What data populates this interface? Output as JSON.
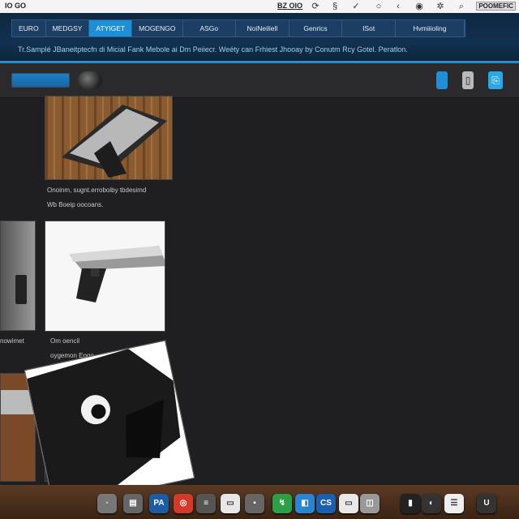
{
  "system_bar": {
    "app_label": "IO GO",
    "code_label": "BZ OIO",
    "status_label": "POOMEFIC",
    "icons": [
      "refresh-icon",
      "s-icon",
      "check-icon",
      "bubble-icon",
      "back-icon",
      "record-icon",
      "gear-icon",
      "search-icon"
    ]
  },
  "nav": {
    "tabs": [
      {
        "label": "EURO",
        "active": false
      },
      {
        "label": "MEDGSY",
        "active": false
      },
      {
        "label": "ATYIGET",
        "active": true
      },
      {
        "label": "MOGENGO",
        "active": false
      },
      {
        "label": "ASGo",
        "active": false
      },
      {
        "label": "NoiNeiliell",
        "active": false
      },
      {
        "label": "Genrics",
        "active": false
      },
      {
        "label": "ISot",
        "active": false
      },
      {
        "label": "Hvmiiioling",
        "active": false
      }
    ],
    "subtitle": "Tr.Samplé JBaneitptecfn di Micial Fank Mebole ai Dm Peiiecr. Weéty can Frhiest Jhooay by Conutm Rcy Gotel. Peratlon."
  },
  "toolbar": {
    "progress_fraction": 1.0,
    "colors": {
      "accent": "#1f8fd8",
      "gray": "#b9b9b9",
      "teal": "#2aa7e6"
    }
  },
  "cards": [
    {
      "caption_lines": [
        "Onoinm, sugnt.erroboiby tbdesimd",
        "Wb Boeip oocoans."
      ]
    },
    {
      "caption_lines": [
        "Om oencil",
        "oygemon Eogo"
      ]
    },
    {
      "caption_lines": [
        "nowimet"
      ]
    }
  ],
  "dock": {
    "items": [
      {
        "glyph": "◦",
        "color": "#777"
      },
      {
        "glyph": "▤",
        "color": "#666"
      },
      {
        "glyph": "PA",
        "color": "#1e5ba0"
      },
      {
        "glyph": "◎",
        "color": "#d23a2a"
      },
      {
        "glyph": "≡",
        "color": "#555"
      },
      {
        "glyph": "▭",
        "color": "#e7e7e7"
      },
      {
        "glyph": "▪",
        "color": "#666"
      },
      {
        "glyph": "↯",
        "color": "#2ba048"
      },
      {
        "glyph": "◧",
        "color": "#2a84d4"
      },
      {
        "glyph": "CS",
        "color": "#1b5fae"
      },
      {
        "glyph": "▭",
        "color": "#e8e8e8"
      },
      {
        "glyph": "◫",
        "color": "#999"
      },
      {
        "glyph": "▮",
        "color": "#222"
      },
      {
        "glyph": "◐",
        "color": "#333"
      },
      {
        "glyph": "☰",
        "color": "#eee"
      },
      {
        "glyph": "U",
        "color": "#333"
      }
    ]
  }
}
